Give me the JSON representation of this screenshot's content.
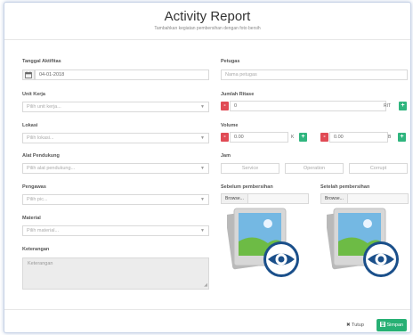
{
  "header": {
    "title": "Activity Report",
    "subtitle": "Tambahkan kegiatan pembersihan dengan foto bersih"
  },
  "left": {
    "tanggal": {
      "label": "Tanggal Aktifitas",
      "value": "04-01-2018"
    },
    "unit_kerja": {
      "label": "Unit Kerja",
      "placeholder": "Pilih unit kerja..."
    },
    "lokasi": {
      "label": "Lokasi",
      "placeholder": "Pilih lokasi..."
    },
    "alat": {
      "label": "Alat Pendukung",
      "placeholder": "Pilih alat pendukung..."
    },
    "pengawas": {
      "label": "Pengawas",
      "placeholder": "Pilih pic..."
    },
    "material": {
      "label": "Material",
      "placeholder": "Pilih material..."
    },
    "keterangan": {
      "label": "Keterangan",
      "placeholder": "Keterangan"
    }
  },
  "right": {
    "petugas": {
      "label": "Petugas",
      "placeholder": "Nama petugas"
    },
    "ritase": {
      "label": "Jumlah Ritase",
      "value": "0",
      "unit": "RIT"
    },
    "volume": {
      "label": "Volume",
      "first_value": "0.00",
      "first_unit": "K",
      "second_value": "0.00",
      "second_unit": "B"
    },
    "jam": {
      "label": "Jam",
      "service": "Service",
      "operation": "Operation",
      "corrupt": "Corrupt"
    },
    "sebelum": {
      "label": "Sebelum pembersihan",
      "browse": "Browse..."
    },
    "setelah": {
      "label": "Setelah pembersihan",
      "browse": "Browse..."
    }
  },
  "footer": {
    "close_label": "✖ Tutup",
    "save_label": "Simpan"
  },
  "colors": {
    "minus": "#e04b55",
    "plus": "#2fb57e",
    "save": "#27b074",
    "eye": "#1a4f8a"
  },
  "icons": [
    "calendar-icon",
    "chevron-down-icon",
    "image-preview-icon",
    "eye-icon",
    "save-icon",
    "close-icon"
  ]
}
